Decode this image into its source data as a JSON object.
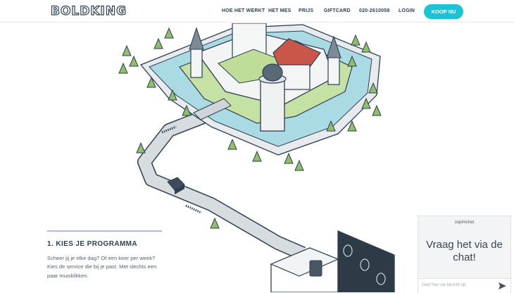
{
  "header": {
    "logo": "BOLDKING",
    "nav": [
      "HOE HET WERKT",
      "HET MES",
      "PRIJS",
      "GIFTCARD",
      "020-2610058",
      "LOGIN"
    ],
    "cta": "KOOP NU",
    "accent_color": "#1bc3d6"
  },
  "step": {
    "title": "1. KIES JE PROGRAMMA",
    "text": "Scheer jij je elke dag? Of een keer per week? Kies de service die bij je past. Met slechts een paar muisklikken."
  },
  "chat": {
    "brand": "zopimchat",
    "message": "Vraag het via de chat!",
    "placeholder": "Geef hier uw bericht op"
  }
}
